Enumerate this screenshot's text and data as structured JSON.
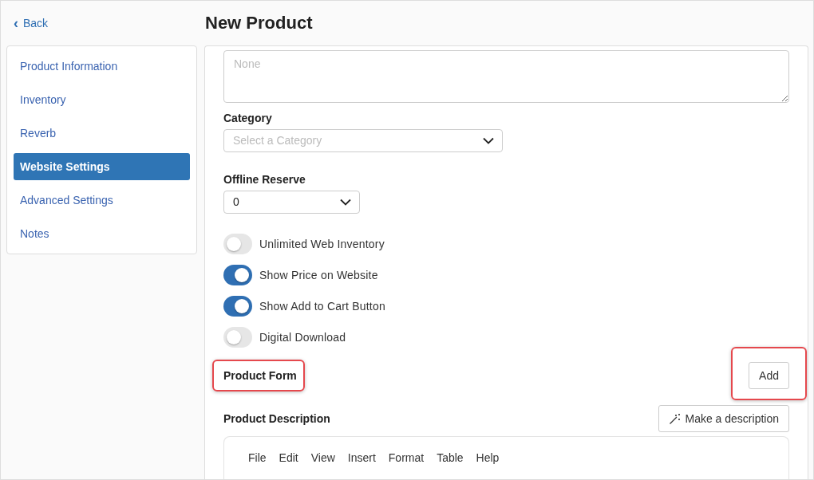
{
  "back_link": {
    "icon": "‹",
    "label": "Back"
  },
  "title": "New Product",
  "sidebar": {
    "items": [
      {
        "label": "Product Information",
        "selected": false
      },
      {
        "label": "Inventory",
        "selected": false
      },
      {
        "label": "Reverb",
        "selected": false
      },
      {
        "label": "Website Settings",
        "selected": true
      },
      {
        "label": "Advanced Settings",
        "selected": false
      },
      {
        "label": "Notes",
        "selected": false
      }
    ]
  },
  "notes_field": {
    "placeholder": "None"
  },
  "category": {
    "label": "Category",
    "placeholder": "Select a Category"
  },
  "offline_reserve": {
    "label": "Offline Reserve",
    "value": "0"
  },
  "toggles": [
    {
      "label": "Unlimited Web Inventory",
      "on": false
    },
    {
      "label": "Show Price on Website",
      "on": true
    },
    {
      "label": "Show Add to Cart Button",
      "on": true
    },
    {
      "label": "Digital Download",
      "on": false
    }
  ],
  "product_form": {
    "label": "Product Form",
    "highlighted": true,
    "button": {
      "label": "Add",
      "highlighted": true
    }
  },
  "product_description": {
    "label": "Product Description",
    "button": "Make a description",
    "editor_menu": [
      "File",
      "Edit",
      "View",
      "Insert",
      "Format",
      "Table",
      "Help"
    ]
  }
}
